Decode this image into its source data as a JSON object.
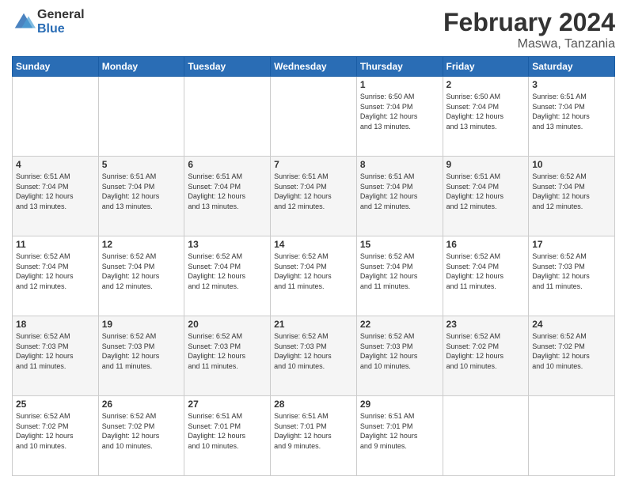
{
  "logo": {
    "general": "General",
    "blue": "Blue"
  },
  "header": {
    "month": "February 2024",
    "location": "Maswa, Tanzania"
  },
  "weekdays": [
    "Sunday",
    "Monday",
    "Tuesday",
    "Wednesday",
    "Thursday",
    "Friday",
    "Saturday"
  ],
  "weeks": [
    [
      {
        "day": "",
        "info": ""
      },
      {
        "day": "",
        "info": ""
      },
      {
        "day": "",
        "info": ""
      },
      {
        "day": "",
        "info": ""
      },
      {
        "day": "1",
        "info": "Sunrise: 6:50 AM\nSunset: 7:04 PM\nDaylight: 12 hours\nand 13 minutes."
      },
      {
        "day": "2",
        "info": "Sunrise: 6:50 AM\nSunset: 7:04 PM\nDaylight: 12 hours\nand 13 minutes."
      },
      {
        "day": "3",
        "info": "Sunrise: 6:51 AM\nSunset: 7:04 PM\nDaylight: 12 hours\nand 13 minutes."
      }
    ],
    [
      {
        "day": "4",
        "info": "Sunrise: 6:51 AM\nSunset: 7:04 PM\nDaylight: 12 hours\nand 13 minutes."
      },
      {
        "day": "5",
        "info": "Sunrise: 6:51 AM\nSunset: 7:04 PM\nDaylight: 12 hours\nand 13 minutes."
      },
      {
        "day": "6",
        "info": "Sunrise: 6:51 AM\nSunset: 7:04 PM\nDaylight: 12 hours\nand 13 minutes."
      },
      {
        "day": "7",
        "info": "Sunrise: 6:51 AM\nSunset: 7:04 PM\nDaylight: 12 hours\nand 12 minutes."
      },
      {
        "day": "8",
        "info": "Sunrise: 6:51 AM\nSunset: 7:04 PM\nDaylight: 12 hours\nand 12 minutes."
      },
      {
        "day": "9",
        "info": "Sunrise: 6:51 AM\nSunset: 7:04 PM\nDaylight: 12 hours\nand 12 minutes."
      },
      {
        "day": "10",
        "info": "Sunrise: 6:52 AM\nSunset: 7:04 PM\nDaylight: 12 hours\nand 12 minutes."
      }
    ],
    [
      {
        "day": "11",
        "info": "Sunrise: 6:52 AM\nSunset: 7:04 PM\nDaylight: 12 hours\nand 12 minutes."
      },
      {
        "day": "12",
        "info": "Sunrise: 6:52 AM\nSunset: 7:04 PM\nDaylight: 12 hours\nand 12 minutes."
      },
      {
        "day": "13",
        "info": "Sunrise: 6:52 AM\nSunset: 7:04 PM\nDaylight: 12 hours\nand 12 minutes."
      },
      {
        "day": "14",
        "info": "Sunrise: 6:52 AM\nSunset: 7:04 PM\nDaylight: 12 hours\nand 11 minutes."
      },
      {
        "day": "15",
        "info": "Sunrise: 6:52 AM\nSunset: 7:04 PM\nDaylight: 12 hours\nand 11 minutes."
      },
      {
        "day": "16",
        "info": "Sunrise: 6:52 AM\nSunset: 7:04 PM\nDaylight: 12 hours\nand 11 minutes."
      },
      {
        "day": "17",
        "info": "Sunrise: 6:52 AM\nSunset: 7:03 PM\nDaylight: 12 hours\nand 11 minutes."
      }
    ],
    [
      {
        "day": "18",
        "info": "Sunrise: 6:52 AM\nSunset: 7:03 PM\nDaylight: 12 hours\nand 11 minutes."
      },
      {
        "day": "19",
        "info": "Sunrise: 6:52 AM\nSunset: 7:03 PM\nDaylight: 12 hours\nand 11 minutes."
      },
      {
        "day": "20",
        "info": "Sunrise: 6:52 AM\nSunset: 7:03 PM\nDaylight: 12 hours\nand 11 minutes."
      },
      {
        "day": "21",
        "info": "Sunrise: 6:52 AM\nSunset: 7:03 PM\nDaylight: 12 hours\nand 10 minutes."
      },
      {
        "day": "22",
        "info": "Sunrise: 6:52 AM\nSunset: 7:03 PM\nDaylight: 12 hours\nand 10 minutes."
      },
      {
        "day": "23",
        "info": "Sunrise: 6:52 AM\nSunset: 7:02 PM\nDaylight: 12 hours\nand 10 minutes."
      },
      {
        "day": "24",
        "info": "Sunrise: 6:52 AM\nSunset: 7:02 PM\nDaylight: 12 hours\nand 10 minutes."
      }
    ],
    [
      {
        "day": "25",
        "info": "Sunrise: 6:52 AM\nSunset: 7:02 PM\nDaylight: 12 hours\nand 10 minutes."
      },
      {
        "day": "26",
        "info": "Sunrise: 6:52 AM\nSunset: 7:02 PM\nDaylight: 12 hours\nand 10 minutes."
      },
      {
        "day": "27",
        "info": "Sunrise: 6:51 AM\nSunset: 7:01 PM\nDaylight: 12 hours\nand 10 minutes."
      },
      {
        "day": "28",
        "info": "Sunrise: 6:51 AM\nSunset: 7:01 PM\nDaylight: 12 hours\nand 9 minutes."
      },
      {
        "day": "29",
        "info": "Sunrise: 6:51 AM\nSunset: 7:01 PM\nDaylight: 12 hours\nand 9 minutes."
      },
      {
        "day": "",
        "info": ""
      },
      {
        "day": "",
        "info": ""
      }
    ]
  ]
}
